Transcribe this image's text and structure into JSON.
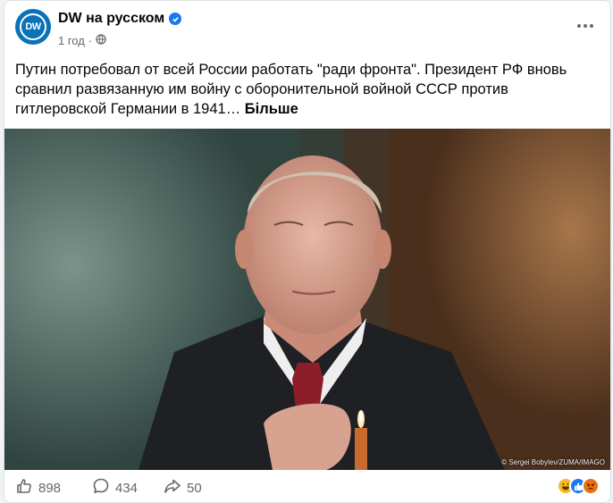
{
  "post": {
    "page_name": "DW на русском",
    "avatar_text": "DW",
    "timestamp": "1 год",
    "text": "Путин потребовал от всей России работать \"ради фронта\". Президент РФ вновь сравнил развязанную им войну с оборонительной войной СССР против гитлеровской Германии в 1941…",
    "see_more": "Більше",
    "photo_credit": "© Sergei Bobylev/ZUMA/IMAGO"
  },
  "footer": {
    "likes": "898",
    "comments": "434",
    "shares": "50"
  },
  "icons": {
    "verified": "verified-badge-icon",
    "privacy": "globe-icon",
    "more": "more-options-icon",
    "like": "thumbs-up-icon",
    "comment": "comment-bubble-icon",
    "share": "share-arrow-icon",
    "reactions": [
      "haha-reaction-icon",
      "like-reaction-icon",
      "angry-reaction-icon"
    ]
  },
  "colors": {
    "brand_blue": "#0b72b9",
    "verified_blue": "#1877f2",
    "text": "#050505",
    "secondary_text": "#65676b"
  }
}
